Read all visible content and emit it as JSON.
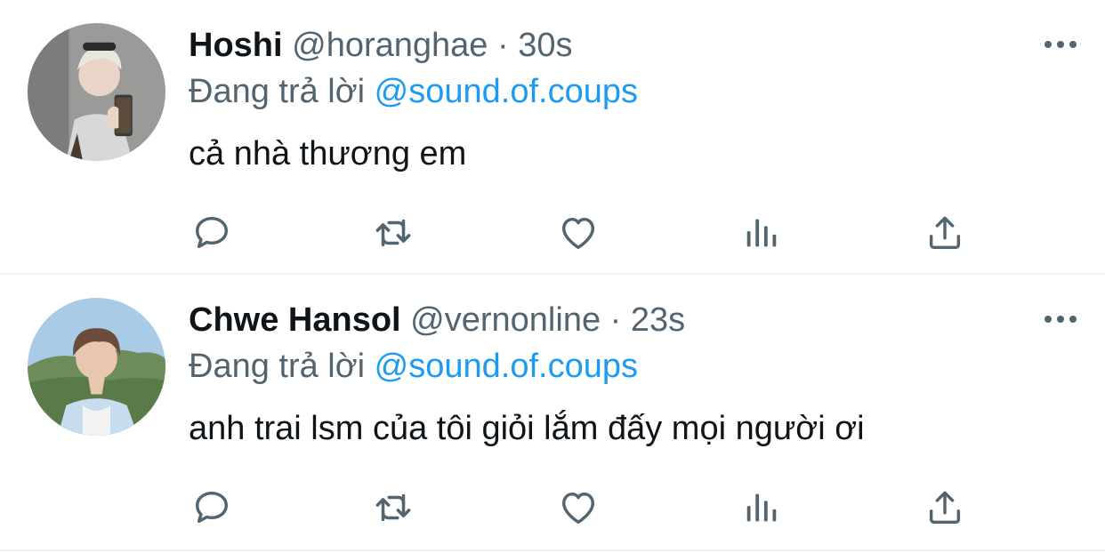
{
  "tweets": [
    {
      "name": "Hoshi",
      "handle": "@horanghae",
      "separator": "·",
      "time": "30s",
      "reply_prefix": "Đang trả lời",
      "reply_mention": "@sound.of.coups",
      "text": "cả nhà thương em",
      "avatar_colors": {
        "bg": "#9a9a98",
        "hair": "#e8e6e0",
        "skin": "#e9d6c8",
        "jacket": "#d8d8d8"
      }
    },
    {
      "name": "Chwe Hansol",
      "handle": "@vernonline",
      "separator": "·",
      "time": "23s",
      "reply_prefix": "Đang trả lời",
      "reply_mention": "@sound.of.coups",
      "text": "anh trai lsm của tôi giỏi lắm đấy mọi người ơi",
      "avatar_colors": {
        "bg": "#a9cbe8",
        "hills": "#6d8c5a",
        "hair": "#6b4c3a",
        "skin": "#e8c6b0",
        "shirt": "#c6dcef"
      }
    }
  ],
  "icons": {
    "more": "more-horizontal-icon",
    "reply": "reply-bubble-icon",
    "retweet": "retweet-icon",
    "like": "heart-icon",
    "stats": "analytics-bars-icon",
    "share": "share-upload-icon"
  },
  "colors": {
    "text": "#0f1419",
    "secondary": "#536471",
    "accent": "#1d9bf0",
    "divider": "#eff3f4"
  }
}
